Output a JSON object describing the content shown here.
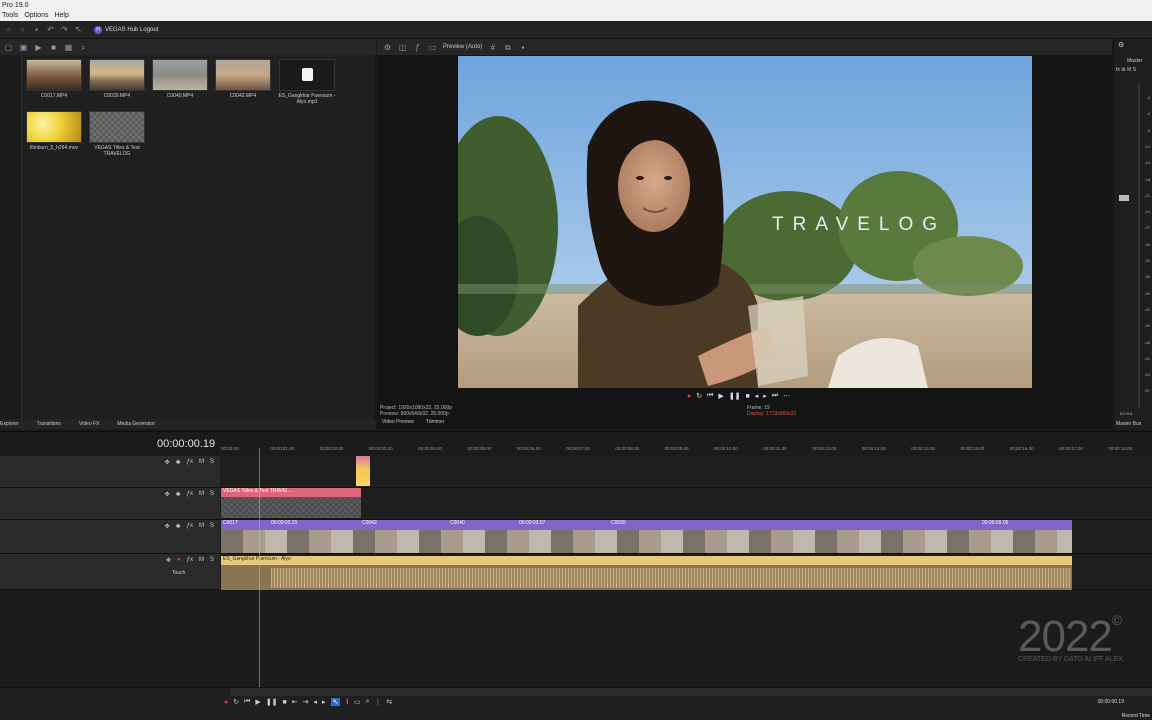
{
  "window": {
    "title": "Pro 19.0"
  },
  "menu": [
    "Tools",
    "Options",
    "Help"
  ],
  "toolbar": {
    "hub_label": "VEGAS Hub Logout"
  },
  "explorer": {
    "items": [
      {
        "label": "C0017.MP4"
      },
      {
        "label": "C0039.MP4"
      },
      {
        "label": "C0040.MP4"
      },
      {
        "label": "C0042.MP4"
      },
      {
        "label": "ES_Gangkhar Puensum - Alyo.mp3"
      },
      {
        "label": "filmburn_5_h264.mov"
      },
      {
        "label": "VEGAS Titles & Text TRAVELOG"
      }
    ],
    "tabs": [
      "Explorer",
      "Transitions",
      "Video FX",
      "Media Generator"
    ]
  },
  "preview": {
    "mode": "Preview (Auto)",
    "overlay_text": "TRAVELOG",
    "project_line": "Project:   1920x1080x32, 25.000p",
    "preview_line": "Preview:   960x540x32, 25.000p",
    "frame_line": "Frame:     19",
    "display_line": "Display:   1723x969x32",
    "tabs": [
      "Video Preview",
      "Trimmer"
    ]
  },
  "master": {
    "title": "Master",
    "ticks": [
      "3",
      "6",
      "9",
      "12",
      "15",
      "18",
      "21",
      "24",
      "27",
      "30",
      "33",
      "36",
      "39",
      "42",
      "45",
      "48",
      "51",
      "54",
      "57"
    ],
    "levels": "0.0   0.0",
    "bus_label": "Master Bus"
  },
  "timeline": {
    "timecode": "00:00:00.19",
    "ruler": [
      "00:00:00",
      "00:00:01.00",
      "00:00:02.00",
      "00:00:03.00",
      "00:00:04.00",
      "00:00:05.00",
      "00:00:06.00",
      "00:00:07.00",
      "00:00:08.00",
      "00:00:09.00",
      "00:00:10.00",
      "00:00:11.00",
      "00:00:12.00",
      "00:00:13.00",
      "00:00:14.00",
      "00:00:15.00",
      "00:00:16.00",
      "00:00:17.00",
      "00:00:18.00"
    ],
    "clips": {
      "title_clip": "VEGAS Titles & Text TRAVEL...",
      "v_c0017": "C0017",
      "v_tc1": "00:00:02.21",
      "v_c0042": "C0042",
      "v_c0040": "C0040",
      "v_tc2": "00:00:03.07",
      "v_c0039": "C0039",
      "v_tc3": "00:00:09.09",
      "audio": "ES_Gangkhar Puensum - Alyo"
    },
    "audio_touch": "Touch",
    "btn_m": "M",
    "btn_s": "S"
  },
  "watermark": {
    "year": "2022",
    "copyright": "©",
    "credit": "CREATED BY DATO ALIFF ALEX"
  },
  "bottom": {
    "timecode": "00:00:00.19",
    "record_time": "Record Time"
  },
  "colors": {
    "accent_video": "#7e67c9",
    "title_clip": "#e0647a",
    "audio_clip": "#e8c87a"
  }
}
